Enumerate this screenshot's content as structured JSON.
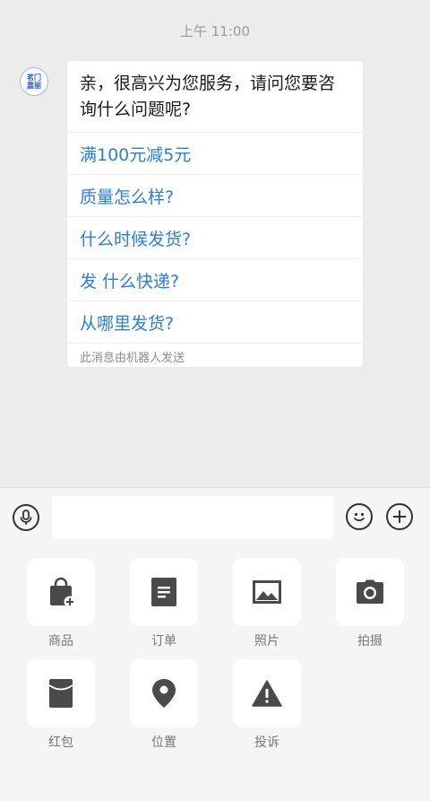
{
  "chat": {
    "timestamp": "上午 11:00",
    "avatar_text": [
      "茗门",
      "嘉丽"
    ],
    "greeting": "亲，很高兴为您服务，请问您要咨询什么问题呢?",
    "quick_replies": [
      "满100元减5元",
      "质量怎么样?",
      "什么时候发货?",
      "发 什么快递?",
      "从哪里发货?"
    ],
    "robot_note": "此消息由机器人发送"
  },
  "input_bar": {
    "text_value": "",
    "icons": [
      "microphone-icon",
      "emoji-icon",
      "plus-icon"
    ]
  },
  "panel": {
    "items": [
      {
        "label": "商品",
        "icon": "shopping-bag-icon"
      },
      {
        "label": "订单",
        "icon": "order-document-icon"
      },
      {
        "label": "照片",
        "icon": "photo-icon"
      },
      {
        "label": "拍摄",
        "icon": "camera-icon"
      },
      {
        "label": "红包",
        "icon": "red-envelope-icon"
      },
      {
        "label": "位置",
        "icon": "location-pin-icon"
      },
      {
        "label": "投诉",
        "icon": "warning-icon"
      }
    ]
  },
  "colors": {
    "link_blue": "#2a7ee0",
    "icon_dark": "#4a4a4a",
    "chat_bg": "#ececec",
    "panel_bg": "#f5f5f5"
  }
}
